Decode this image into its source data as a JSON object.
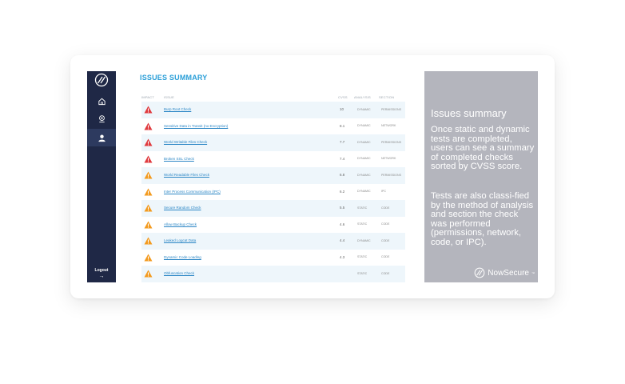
{
  "nav": {
    "items": [
      {
        "name": "home",
        "icon": "home-icon"
      },
      {
        "name": "scan",
        "icon": "scan-icon"
      },
      {
        "name": "user",
        "icon": "user-icon"
      }
    ],
    "logout_label": "Logout",
    "logout_arrow": "→"
  },
  "main": {
    "title": "ISSUES SUMMARY",
    "columns": {
      "impact": "IMPACT",
      "issue": "ISSUE",
      "cvss": "CVSS",
      "analysis": "ANALYSIS",
      "section": "SECTION"
    },
    "rows": [
      {
        "severity": "high",
        "issue": "Burp Root Check",
        "cvss": "10",
        "analysis": "DYNAMIC",
        "section": "PERMISSIONS"
      },
      {
        "severity": "high",
        "issue": "Sensitive Data in Transit (no Encryption)",
        "cvss": "8.1",
        "analysis": "DYNAMIC",
        "section": "NETWORK"
      },
      {
        "severity": "high",
        "issue": "World Writable Files Check",
        "cvss": "7.7",
        "analysis": "DYNAMIC",
        "section": "PERMISSIONS"
      },
      {
        "severity": "high",
        "issue": "Broken SSL Check",
        "cvss": "7.4",
        "analysis": "DYNAMIC",
        "section": "NETWORK"
      },
      {
        "severity": "medium",
        "issue": "World Readable Files Check",
        "cvss": "6.8",
        "analysis": "DYNAMIC",
        "section": "PERMISSIONS"
      },
      {
        "severity": "medium",
        "issue": "Inter Process Communication (IPC)",
        "cvss": "6.2",
        "analysis": "DYNAMIC",
        "section": "IPC"
      },
      {
        "severity": "medium",
        "issue": "Secure Random Check",
        "cvss": "5.5",
        "analysis": "STATIC",
        "section": "CODE"
      },
      {
        "severity": "medium",
        "issue": "Allow Backup Check",
        "cvss": "4.6",
        "analysis": "STATIC",
        "section": "CODE"
      },
      {
        "severity": "medium",
        "issue": "Leaked Logcat Data",
        "cvss": "4.4",
        "analysis": "DYNAMIC",
        "section": "CODE"
      },
      {
        "severity": "medium",
        "issue": "Dynamic Code Loading",
        "cvss": "4.3",
        "analysis": "STATIC",
        "section": "CODE"
      },
      {
        "severity": "medium",
        "issue": "Obfuscation Check",
        "cvss": "",
        "analysis": "STATIC",
        "section": "CODE"
      }
    ]
  },
  "panel": {
    "heading": "Issues summary",
    "paragraph1": "Once static and dynamic tests are completed, users can see a summary of completed checks sorted by CVSS score.",
    "paragraph2": "Tests are also classi-fied by the method of analysis and section the check was performed (permissions, network, code, or IPC).",
    "brand": "NowSecure",
    "trademark": "™"
  },
  "colors": {
    "sidebar": "#1f2846",
    "accent": "#2b9fd8",
    "severity_high": "#e03a3e",
    "severity_medium": "#f39a1e",
    "panel": "#b4b5bd"
  }
}
